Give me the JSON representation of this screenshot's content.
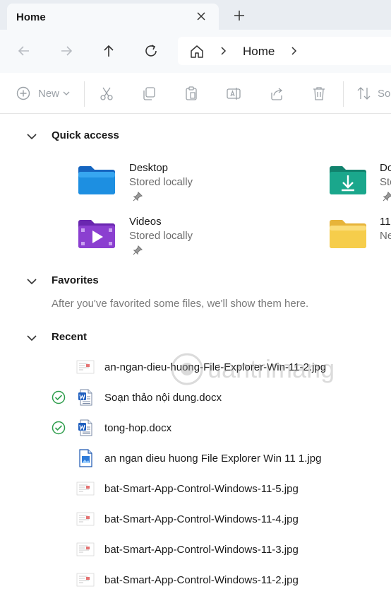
{
  "tab": {
    "title": "Home",
    "close_icon": "close-icon",
    "new_tab_icon": "plus-icon"
  },
  "nav": {
    "back_icon": "arrow-left-icon",
    "forward_icon": "arrow-right-icon",
    "up_icon": "arrow-up-icon",
    "refresh_icon": "refresh-icon"
  },
  "address": {
    "home_icon": "home-icon",
    "location": "Home"
  },
  "commands": {
    "new_label": "New",
    "sort_label": "Sort",
    "icons": [
      "plus-circle-icon",
      "chevron-down-icon",
      "cut-icon",
      "copy-icon",
      "paste-icon",
      "rename-icon",
      "share-icon",
      "delete-icon",
      "sort-icon"
    ]
  },
  "quick_access": {
    "label": "Quick access",
    "items": [
      {
        "name": "Desktop",
        "sub": "Stored locally",
        "icon": "desktop-folder-icon",
        "color": "#1d8fe1"
      },
      {
        "name": "Do",
        "sub": "Sto",
        "icon": "downloads-folder-icon",
        "color": "#1aa78c"
      },
      {
        "name": "Videos",
        "sub": "Stored locally",
        "icon": "videos-folder-icon",
        "color": "#8b3fd0"
      },
      {
        "name": "11",
        "sub": "Ne",
        "icon": "folder-icon",
        "color": "#f6cd4b"
      }
    ]
  },
  "favorites": {
    "label": "Favorites",
    "empty_message": "After you've favorited some files, we'll show them here."
  },
  "recent": {
    "label": "Recent",
    "files": [
      {
        "name": "an-ngan-dieu-huong-File-Explorer-Win-11-2.jpg",
        "thumb": "image-thumb-icon",
        "synced": false
      },
      {
        "name": "Soạn thảo nội dung.docx",
        "thumb": "word-doc-icon",
        "synced": true
      },
      {
        "name": "tong-hop.docx",
        "thumb": "word-doc-icon",
        "synced": true
      },
      {
        "name": "an ngan dieu huong File Explorer Win 11 1.jpg",
        "thumb": "image-file-icon",
        "synced": false
      },
      {
        "name": "bat-Smart-App-Control-Windows-11-5.jpg",
        "thumb": "image-thumb-icon",
        "synced": false
      },
      {
        "name": "bat-Smart-App-Control-Windows-11-4.jpg",
        "thumb": "image-thumb-icon",
        "synced": false
      },
      {
        "name": "bat-Smart-App-Control-Windows-11-3.jpg",
        "thumb": "image-thumb-icon",
        "synced": false
      },
      {
        "name": "bat-Smart-App-Control-Windows-11-2.jpg",
        "thumb": "image-thumb-icon",
        "synced": false
      }
    ]
  },
  "watermark": {
    "text": "uantrimang"
  },
  "colors": {
    "accent": "#0067c0",
    "sync_ok": "#2e9d4c",
    "tab_strip": "#e9edf2",
    "nav_bg": "#f7f9fb"
  }
}
